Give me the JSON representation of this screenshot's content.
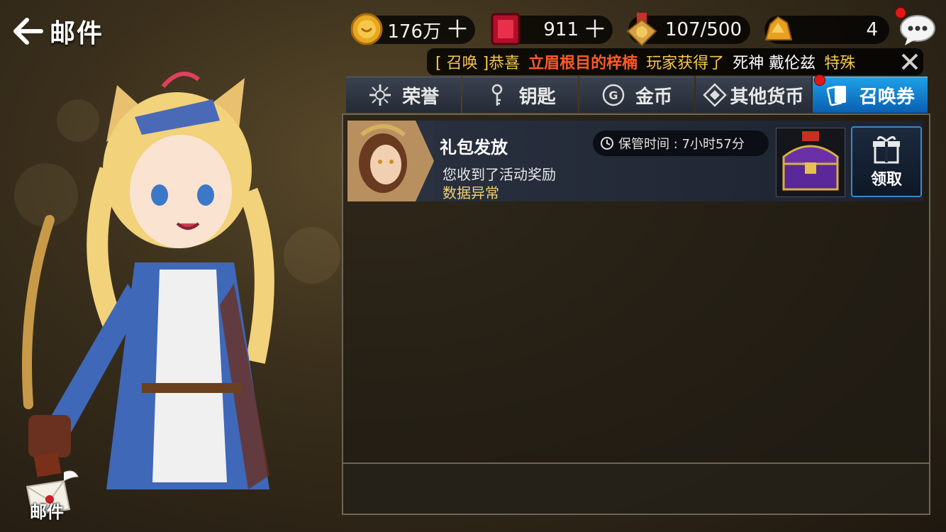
{
  "header": {
    "back_icon": "arrow-left-icon",
    "title": "邮件"
  },
  "currencies": [
    {
      "icon": "gold-coin-icon",
      "value": "176万",
      "has_plus": true
    },
    {
      "icon": "red-gem-icon",
      "value": "911",
      "has_plus": true
    },
    {
      "icon": "medal-icon",
      "value": "107/500",
      "has_plus": false
    },
    {
      "icon": "gold-ore-icon",
      "value": "4",
      "has_plus": false
    }
  ],
  "chat": {
    "icon": "chat-bubble-icon",
    "has_notification": true
  },
  "ticker": {
    "prefix": "[ 召唤 ]恭喜",
    "player": "立眉根目的梓楠",
    "middle": "玩家获得了",
    "item": "死神 戴伦兹",
    "suffix": "特殊",
    "close_icon": "close-icon"
  },
  "tabs": [
    {
      "label": "荣誉",
      "icon": "honor-icon",
      "active": false,
      "badge": false
    },
    {
      "label": "钥匙",
      "icon": "key-icon",
      "active": false,
      "badge": false
    },
    {
      "label": "金币",
      "icon": "gold-g-icon",
      "active": false,
      "badge": false
    },
    {
      "label": "其他货币",
      "icon": "diamond-currency-icon",
      "active": false,
      "badge": false
    },
    {
      "label": "召唤券",
      "icon": "summon-ticket-icon",
      "active": true,
      "badge": true
    }
  ],
  "mail": [
    {
      "title": "礼包发放",
      "description": "您收到了活动奖励",
      "note": "数据异常",
      "timer_label": "保管时间 : 7小时57分",
      "reward_icon": "purple-treasure-chest-icon",
      "claim_label": "领取"
    }
  ],
  "bottom": {
    "mail_shortcut_label": "邮件"
  },
  "colors": {
    "tab_active": "#1ea0e8",
    "ticker_highlight": "#ff5a28",
    "ticker_text": "#f5c84a",
    "notification": "#e01818"
  }
}
